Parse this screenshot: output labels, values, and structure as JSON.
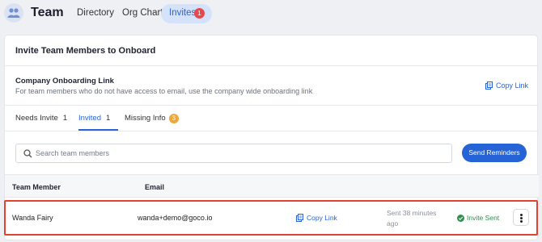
{
  "header": {
    "title": "Team",
    "nav": [
      {
        "label": "Directory"
      },
      {
        "label": "Org Chart"
      },
      {
        "label": "Invites",
        "badge": "1"
      }
    ]
  },
  "card": {
    "title": "Invite Team Members to Onboard",
    "link_section": {
      "title": "Company Onboarding Link",
      "description": "For team members who do not have access to email, use the company wide onboarding link",
      "copy_label": "Copy Link"
    },
    "tabs": [
      {
        "label": "Needs Invite",
        "count": "1"
      },
      {
        "label": "Invited",
        "count": "1",
        "active": true
      },
      {
        "label": "Missing Info",
        "badge": "3"
      }
    ],
    "search": {
      "placeholder": "Search team members"
    },
    "send_button": "Send Reminders",
    "table": {
      "columns": [
        "Team Member",
        "Email"
      ],
      "rows": [
        {
          "name": "Wanda Fairy",
          "email": "wanda+demo@goco.io",
          "copy_label": "Copy Link",
          "sent": "Sent 38 minutes ago",
          "status": "Invite Sent"
        }
      ]
    }
  },
  "colors": {
    "accent": "#2563d6",
    "danger": "#e5484d",
    "warning": "#efa73c",
    "success": "#2e8f4b",
    "highlight_border": "#e2422f"
  },
  "icons": [
    "team-icon",
    "copy-link-icon",
    "search-icon",
    "check-circle-icon",
    "more-vertical-icon"
  ]
}
